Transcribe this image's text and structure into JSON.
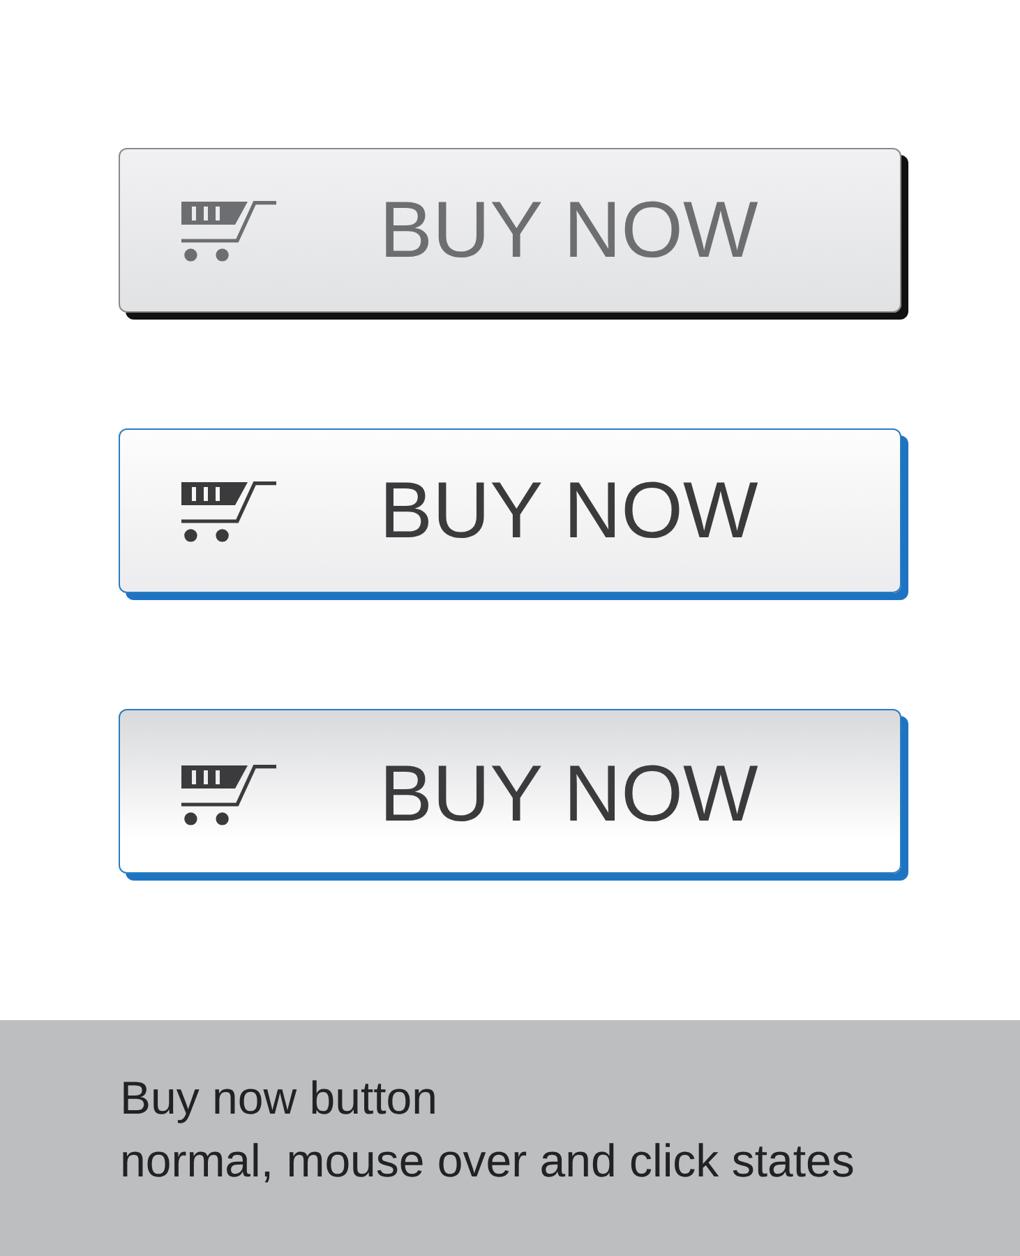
{
  "buttons": [
    {
      "label": "BUY NOW",
      "hovered": false,
      "pressed": false
    },
    {
      "label": "BUY NOW",
      "hovered": true,
      "pressed": false
    },
    {
      "label": "BUY NOW",
      "hovered": true,
      "pressed": true
    }
  ],
  "caption": {
    "title": "Buy now button",
    "subtitle": "normal, mouse over and click states"
  }
}
